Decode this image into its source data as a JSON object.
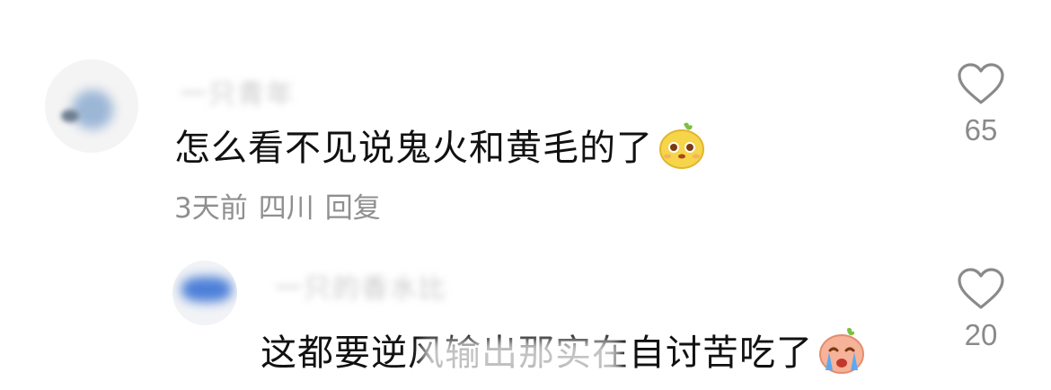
{
  "comments": [
    {
      "username": "一只青年",
      "text": "怎么看不见说鬼火和黄毛的了",
      "emoji_icon": "yellow-bean-face-emoji",
      "time": "3天前",
      "location": "四川",
      "reply_label": "回复",
      "likes": "65"
    },
    {
      "username": "一只的香水比",
      "text": "这都要逆风输出那实在自讨苦吃了",
      "emoji_icon": "crying-pink-bean-emoji",
      "likes": "20"
    }
  ],
  "colors": {
    "primary_text": "#111111",
    "secondary_text": "#8f8f8f",
    "heart_stroke": "#8a8a8a"
  }
}
